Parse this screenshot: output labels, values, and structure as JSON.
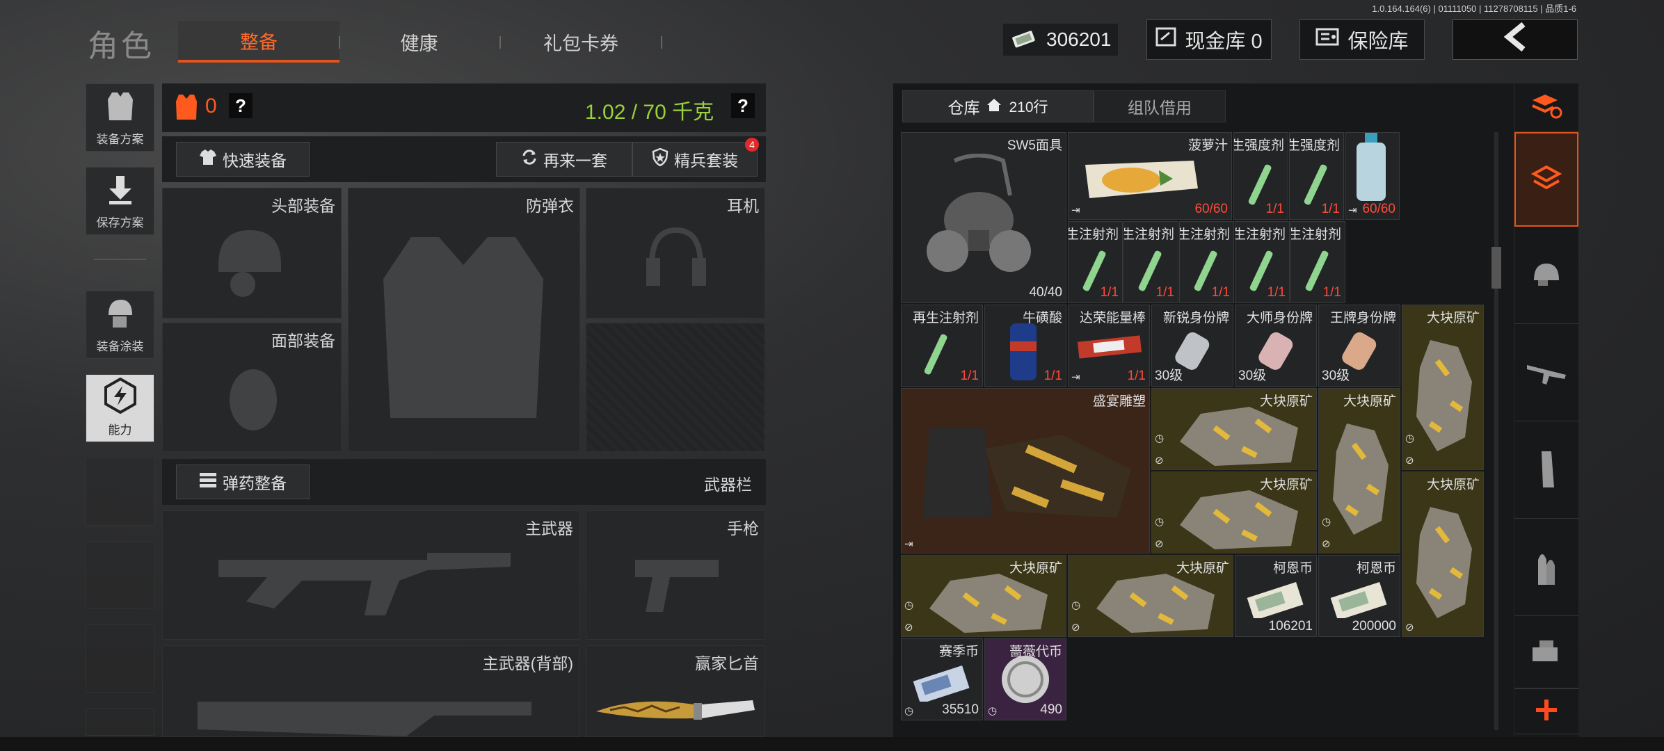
{
  "version_text": "1.0.164.164(6) | 01111050 | 11278708115 | 品质1-6",
  "header": {
    "title": "角色",
    "tabs": [
      "整备",
      "健康",
      "礼包卡券"
    ],
    "currency_value": "306201",
    "cash_vault": "现金库 0",
    "insurance_vault": "保险库"
  },
  "side_menu": [
    {
      "label": "装备方案"
    },
    {
      "label": "保存方案"
    },
    {
      "label": "装备涂装"
    },
    {
      "label": "能力"
    }
  ],
  "equipment": {
    "armor_count": "0",
    "help_glyph": "?",
    "weight": "1.02 / 70 千克",
    "quick_equip": "快速装备",
    "again_set": "再来一套",
    "elite_set": "精兵套装",
    "elite_badge": "4",
    "slots": {
      "head": "头部装备",
      "vest": "防弹衣",
      "headset": "耳机",
      "face": "面部装备"
    },
    "ammo_btn": "弹药整备",
    "weapon_bar": "武器栏",
    "main_weapon": "主武器",
    "pistol": "手枪",
    "main_weapon_back": "主武器(背部)",
    "knife": "赢家匕首"
  },
  "warehouse": {
    "tab_storage": "仓库",
    "rows": "210行",
    "tab_team": "组队借用",
    "items": [
      {
        "name": "SW5面具",
        "count": "40/40"
      },
      {
        "name": "菠萝汁",
        "count": "60/60"
      },
      {
        "name": "再生强度剂",
        "count": "1/1"
      },
      {
        "name": "再生强度剂",
        "count": "1/1"
      },
      {
        "name": "",
        "count": "60/60"
      },
      {
        "name": "再生注射剂",
        "count": "1/1"
      },
      {
        "name": "再生注射剂",
        "count": "1/1"
      },
      {
        "name": "再生注射剂",
        "count": "1/1"
      },
      {
        "name": "再生注射剂",
        "count": "1/1"
      },
      {
        "name": "再生注射剂",
        "count": "1/1"
      },
      {
        "name": "再生注射剂",
        "count": "1/1"
      },
      {
        "name": "牛磺酸",
        "count": "1/1"
      },
      {
        "name": "达荣能量棒",
        "count": "1/1"
      },
      {
        "name": "新锐身份牌",
        "count": "30级"
      },
      {
        "name": "大师身份牌",
        "count": "30级"
      },
      {
        "name": "王牌身份牌",
        "count": "30级"
      },
      {
        "name": "大块原矿",
        "count": ""
      },
      {
        "name": "盛宴雕塑",
        "count": ""
      },
      {
        "name": "大块原矿",
        "count": ""
      },
      {
        "name": "大块原矿",
        "count": ""
      },
      {
        "name": "大块原矿",
        "count": ""
      },
      {
        "name": "大块原矿",
        "count": ""
      },
      {
        "name": "大块原矿",
        "count": ""
      },
      {
        "name": "大块原矿",
        "count": ""
      },
      {
        "name": "柯恩币",
        "count": "106201"
      },
      {
        "name": "柯恩币",
        "count": "200000"
      },
      {
        "name": "赛季币",
        "count": "35510"
      },
      {
        "name": "蔷薇代币",
        "count": "490"
      }
    ]
  },
  "colors": {
    "accent": "#e2541d",
    "weight_green": "#9bd23c",
    "count_red": "#ff4a3a"
  }
}
